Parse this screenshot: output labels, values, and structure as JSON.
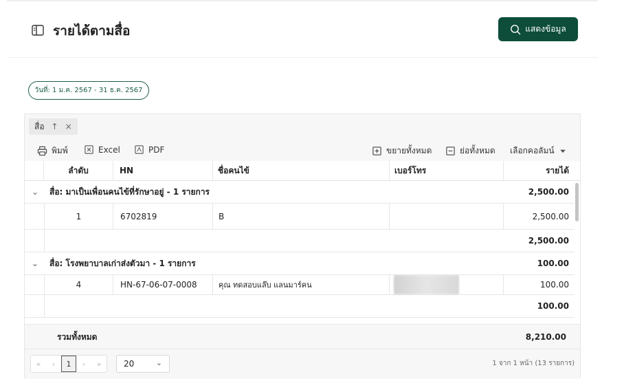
{
  "page": {
    "title": "รายได้ตามสื่อ",
    "show_button": "แสดงข้อมูล",
    "date_range": "วันที่: 1 ม.ค. 2567 - 31 ธ.ค. 2567"
  },
  "grouping": {
    "chip_label": "สื่อ",
    "sort_symbol": "↑",
    "remove_symbol": "×"
  },
  "toolbar": {
    "print": "พิมพ์",
    "excel": "Excel",
    "pdf": "PDF",
    "expand_all": "ขยายทั้งหมด",
    "collapse_all": "ย่อทั้งหมด",
    "choose_columns": "เลือกคอลัมน์"
  },
  "columns": {
    "index": "ลำดับ",
    "hn": "HN",
    "patient_name": "ชื่อคนไข้",
    "phone": "เบอร์โทร",
    "revenue": "รายได้"
  },
  "groups": [
    {
      "label": "สื่อ: มาเป็นเพื่อนคนไข้ที่รักษาอยู่ - 1 รายการ",
      "amount": "2,500.00",
      "rows": [
        {
          "index": "1",
          "hn": "6702819",
          "name": "B",
          "phone": "",
          "revenue": "2,500.00"
        }
      ],
      "subtotal": "2,500.00"
    },
    {
      "label": "สื่อ: โรงพยาบาลเก่าส่งตัวมา - 1 รายการ",
      "amount": "100.00",
      "rows": [
        {
          "index": "4",
          "hn": "HN-67-06-07-0008",
          "name": "คุณ ทดสอบแล๊บ แลนมาร์คน",
          "phone": "",
          "revenue": "100.00"
        }
      ],
      "subtotal": "100.00"
    }
  ],
  "footer": {
    "total_label": "รวมทั้งหมด",
    "total_amount": "8,210.00"
  },
  "pager": {
    "first": "«",
    "prev": "‹",
    "current_page": "1",
    "next": "›",
    "last": "»",
    "page_size": "20",
    "info": "1 จาก 1 หน้า (13 รายการ)"
  },
  "colors": {
    "primary": "#0d4d3a",
    "accent_text": "#1e5c48"
  },
  "icons": {
    "title": "book-panel-icon",
    "search": "search-icon",
    "print": "printer-icon",
    "excel": "excel-icon",
    "pdf": "pdf-icon",
    "expand": "expand-icon",
    "collapse": "collapse-icon",
    "dropdown": "caret-down-icon"
  }
}
